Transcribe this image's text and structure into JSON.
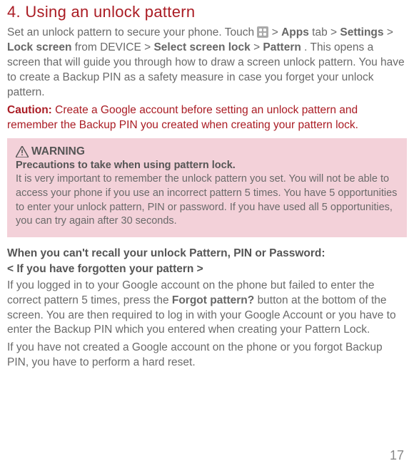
{
  "section": {
    "title": "4. Using an unlock pattern",
    "intro1a": "Set an unlock pattern to secure your phone. Touch ",
    "intro1b": " > ",
    "apps": "Apps",
    "intro1c": " tab > ",
    "settings": "Settings",
    "intro1d": " > ",
    "lockscreen": "Lock screen",
    "intro1e": " from DEVICE > ",
    "selectlock": "Select screen lock",
    "intro1f": " > ",
    "pattern": "Pattern",
    "intro1g": ". This opens a screen that will guide you through how to draw a screen unlock pattern. You have to create a Backup PIN as a safety measure in case you forget your unlock pattern.",
    "caution_label": "Caution:",
    "caution_body": " Create a Google account before setting an unlock pattern and remember the Backup PIN you created when creating your pattern lock."
  },
  "warning": {
    "title": " WARNING",
    "subtitle": "Precautions to take when using pattern lock.",
    "body": "It is very important to remember the unlock pattern you set. You will not be able to access your phone if you use an incorrect pattern 5 times. You have 5 opportunities to enter your unlock pattern, PIN or password. If you have used all 5 opportunities, you can try again after 30 seconds."
  },
  "recall": {
    "heading": "When you can't recall your unlock Pattern, PIN or Password:",
    "subheading": "< If you have forgotten your pattern >",
    "para1a": "If you logged in to your Google account on the phone but failed to enter the correct pattern 5 times, press the ",
    "forgot": "Forgot pattern?",
    "para1b": " button at the bottom of the screen. You are then required to log in with your Google Account or you have to enter the Backup PIN which you entered when creating your Pattern Lock.",
    "para2": "If you have not created a Google account on the phone or you forgot Backup PIN, you have to perform a hard reset."
  },
  "page_number": "17"
}
